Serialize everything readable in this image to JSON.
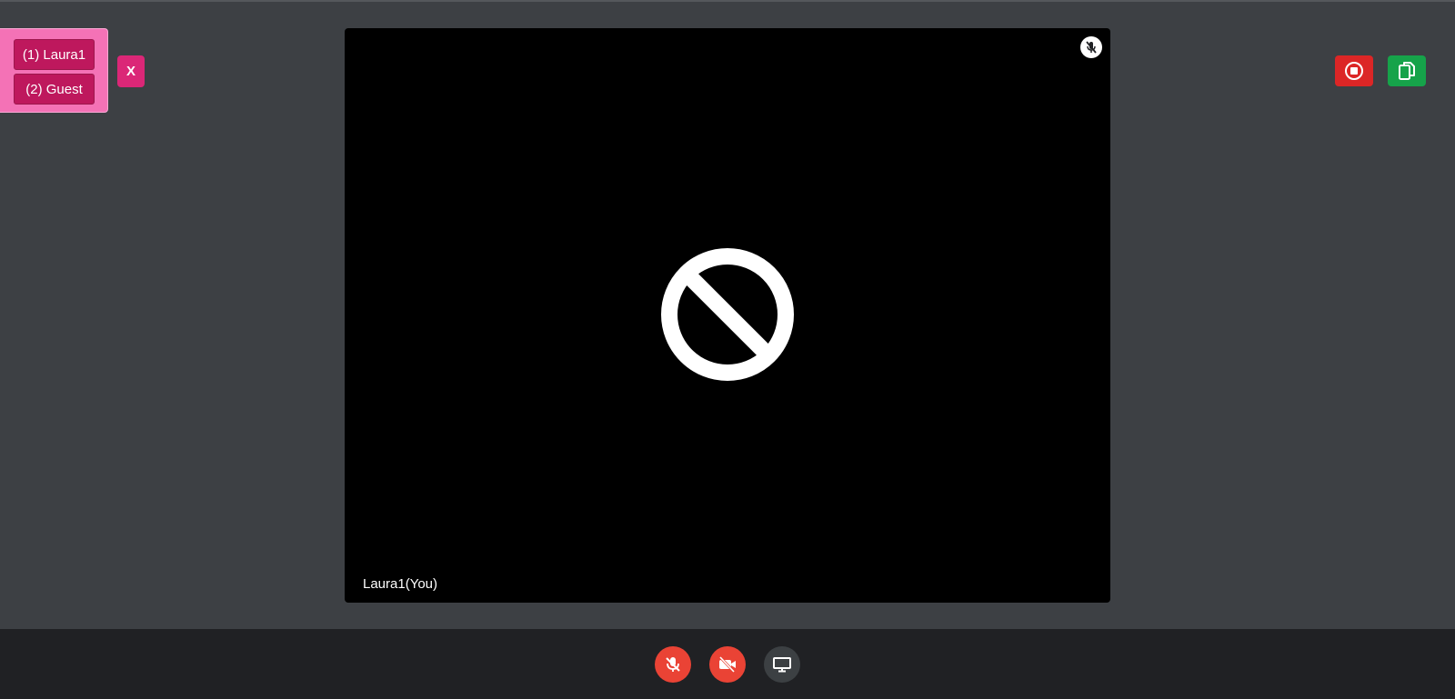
{
  "participants": {
    "items": [
      {
        "label": "(1) Laura1"
      },
      {
        "label": "(2) Guest"
      }
    ],
    "close_label": "X"
  },
  "video_tile": {
    "name": "Laura1(You)",
    "muted": true,
    "camera_off": true
  },
  "top_right": {
    "record_icon": "stop-record-icon",
    "copy_icon": "copy-icon"
  },
  "controls": [
    {
      "name": "mic-off-icon",
      "state": "off"
    },
    {
      "name": "video-off-icon",
      "state": "off"
    },
    {
      "name": "screen-share-icon",
      "state": "inactive"
    }
  ],
  "colors": {
    "background": "#3d4044",
    "participants_panel": "#f472b6",
    "participant_button": "#be185d",
    "close_button": "#db2777",
    "record_button": "#dc2626",
    "copy_button": "#16a34a",
    "control_bar": "#202124",
    "control_off": "#ea4335",
    "control_neutral": "#3c4043"
  }
}
